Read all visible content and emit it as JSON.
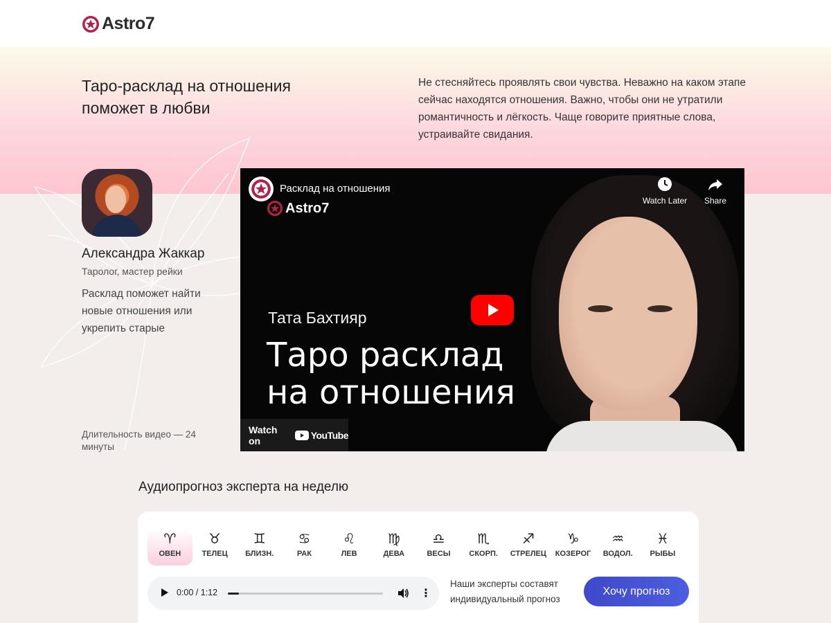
{
  "header": {
    "brand": "Astro7"
  },
  "hero": {
    "title": "Таро-расклад на отношения поможет в любви",
    "text": "Не стесняйтесь проявлять свои чувства. Неважно на каком этапе сейчас находятся отношения. Важно, чтобы они не утратили романтичность и лёгкость. Чаще говорите приятные слова, устраивайте свидания."
  },
  "author": {
    "name": "Александра Жаккар",
    "role": "Таролог, мастер рейки",
    "description": "Расклад поможет найти новые отношения или укрепить старые"
  },
  "duration": "Длительность видео — 24 минуты",
  "video": {
    "title": "Расклад на отношения",
    "brand": "Astro7",
    "watch_later": "Watch Later",
    "share": "Share",
    "person_name": "Тата Бахтияр",
    "headline_line1": "Таро расклад",
    "headline_line2": "на отношения",
    "watch_on": "Watch on",
    "youtube": "YouTube"
  },
  "audio": {
    "title": "Аудиопрогноз эксперта на неделю",
    "signs": [
      {
        "symbol": "♈",
        "label": "ОВЕН",
        "active": true
      },
      {
        "symbol": "♉",
        "label": "ТЕЛЕЦ"
      },
      {
        "symbol": "♊",
        "label": "БЛИЗН."
      },
      {
        "symbol": "♋",
        "label": "РАК"
      },
      {
        "symbol": "♌",
        "label": "ЛЕВ"
      },
      {
        "symbol": "♍",
        "label": "ДЕВА"
      },
      {
        "symbol": "♎",
        "label": "ВЕСЫ"
      },
      {
        "symbol": "♏",
        "label": "СКОРП."
      },
      {
        "symbol": "♐",
        "label": "СТРЕЛЕЦ"
      },
      {
        "symbol": "♑",
        "label": "КОЗЕРОГ"
      },
      {
        "symbol": "♒",
        "label": "ВОДОЛ."
      },
      {
        "symbol": "♓",
        "label": "РЫБЫ"
      }
    ],
    "player": {
      "time": "0:00 / 1:12",
      "progress": 0.07
    },
    "hint": "Наши эксперты составят индивидуальный прогноз",
    "cta": "Хочу прогноз"
  },
  "colors": {
    "brand": "#b3204a",
    "cta": "#4553d6",
    "youtube_red": "#ff0000"
  }
}
